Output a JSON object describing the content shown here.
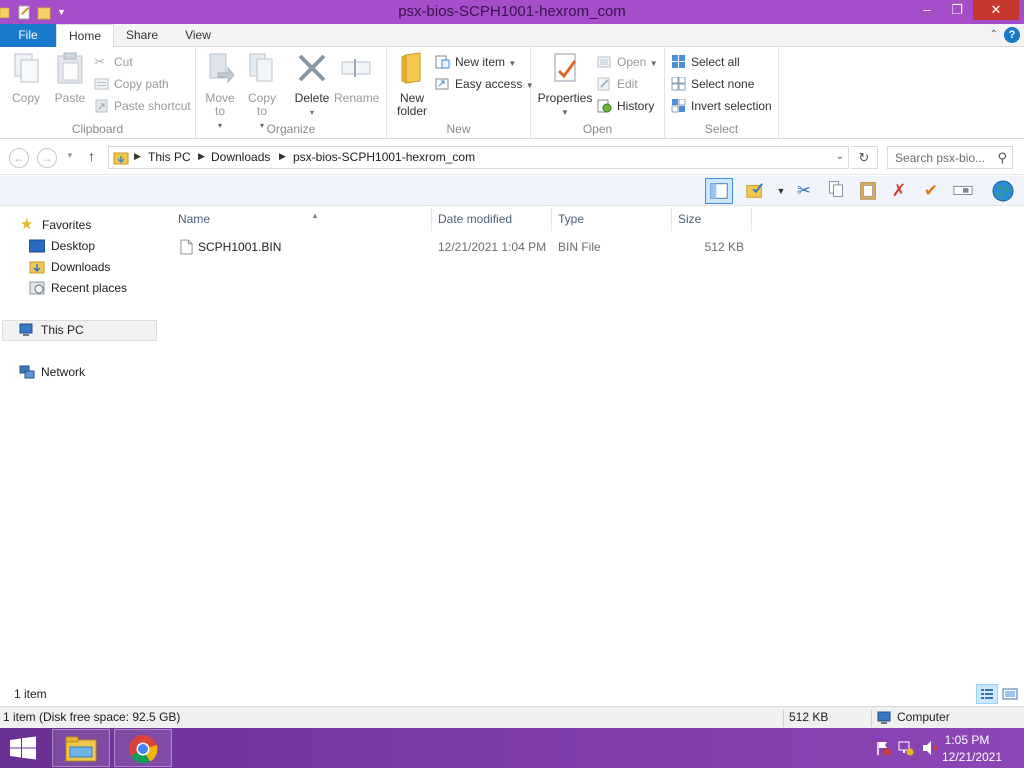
{
  "window": {
    "title": "psx-bios-SCPH1001-hexrom_com",
    "minimize": "‒",
    "maximize": "❐",
    "close": "✕"
  },
  "ribbon_tabs": {
    "file": "File",
    "home": "Home",
    "share": "Share",
    "view": "View",
    "help": "?"
  },
  "ribbon": {
    "clipboard": {
      "label": "Clipboard",
      "copy": "Copy",
      "paste": "Paste",
      "cut": "Cut",
      "copy_path": "Copy path",
      "paste_shortcut": "Paste shortcut"
    },
    "organize": {
      "label": "Organize",
      "move_to": "Move to",
      "copy_to": "Copy to",
      "delete": "Delete",
      "rename": "Rename"
    },
    "new": {
      "label": "New",
      "new_folder": "New folder",
      "new_item": "New item",
      "easy_access": "Easy access"
    },
    "open": {
      "label": "Open",
      "properties": "Properties",
      "open": "Open",
      "edit": "Edit",
      "history": "History"
    },
    "select": {
      "label": "Select",
      "select_all": "Select all",
      "select_none": "Select none",
      "invert_selection": "Invert selection"
    }
  },
  "address": {
    "crumbs": [
      "This PC",
      "Downloads",
      "psx-bios-SCPH1001-hexrom_com"
    ],
    "search_placeholder": "Search psx-bio..."
  },
  "nav": {
    "favorites": "Favorites",
    "desktop": "Desktop",
    "downloads": "Downloads",
    "recent_places": "Recent places",
    "this_pc": "This PC",
    "network": "Network"
  },
  "columns": {
    "name": "Name",
    "date_modified": "Date modified",
    "type": "Type",
    "size": "Size"
  },
  "files": [
    {
      "name": "SCPH1001.BIN",
      "date_modified": "12/21/2021 1:04 PM",
      "type": "BIN File",
      "size": "512 KB"
    }
  ],
  "status": {
    "item_count": "1 item",
    "detail": "1 item (Disk free space: 92.5 GB)",
    "size": "512 KB",
    "location": "Computer"
  },
  "taskbar": {
    "time": "1:05 PM",
    "date": "12/21/2021"
  },
  "colors": {
    "title_bar": "#a64dc9",
    "file_tab": "#1979ca",
    "taskbar": "#7a3aa6",
    "close_button": "#c7372f"
  }
}
